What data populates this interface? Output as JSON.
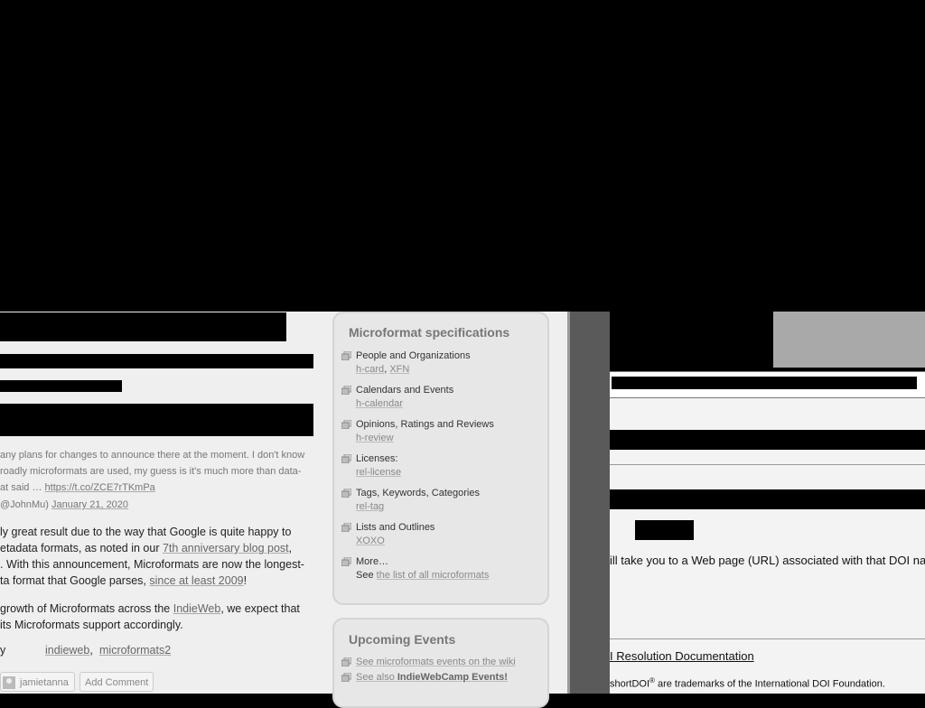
{
  "tweet": {
    "lines": [
      "any plans for changes to announce there at the moment. I don't know",
      "roadly microformats are used, my guess is it's much more than data-"
    ],
    "line3_prefix": "at said … ",
    "link": "https://t.co/ZCE7rTKmPa",
    "author_handle": "@JohnMu)",
    "date": "January 21, 2020"
  },
  "post": {
    "para1": {
      "l1": "ly great result due to the way that Google is quite happy to",
      "l2_prefix": "etadata formats, as noted in our ",
      "l2_link": "7th anniversary blog post",
      "l2_suffix": ",",
      "l3": ". With this announcement, Microformats are now the longest-",
      "l4_prefix": "ta format that Google parses, ",
      "l4_link": "since at least 2009",
      "l4_suffix": "!"
    },
    "para2": {
      "l1_prefix": " growth of Microformats across the ",
      "l1_link": "IndieWeb",
      "l1_suffix": ", we expect that",
      "l2": " its Microformats support accordingly."
    },
    "tags_label": "y",
    "tags": [
      "indieweb",
      "microformats2"
    ],
    "tag_separator": ",",
    "author": "jamietanna",
    "add_comment": "Add Comment"
  },
  "sidebar": {
    "specs_title": "Microformat specifications",
    "specs": [
      {
        "label": "People and Organizations",
        "links": [
          "h-card",
          "XFN"
        ]
      },
      {
        "label": "Calendars and Events",
        "links": [
          "h-calendar"
        ]
      },
      {
        "label": "Opinions, Ratings and Reviews",
        "links": [
          "h-review"
        ]
      },
      {
        "label": "Licenses:",
        "links": [
          "rel-license"
        ]
      },
      {
        "label": "Tags, Keywords, Categories",
        "links": [
          "rel-tag"
        ]
      },
      {
        "label": "Lists and Outlines",
        "links": [
          "XOXO"
        ]
      }
    ],
    "more": {
      "label": "More…",
      "prefix": "See ",
      "link": "the list of all microformats"
    },
    "events_title": "Upcoming Events",
    "events": [
      {
        "prefix": "",
        "link": "See microformats events on the wiki",
        "bold": ""
      },
      {
        "prefix": "See also ",
        "link": "",
        "bold": "IndieWebCamp Events!"
      }
    ]
  },
  "doi": {
    "text": "ill take you to a Web page (URL) associated with that DOI na",
    "doc_link": "I Resolution Documentation",
    "tm_prefix": "shortDOI",
    "tm_sup": "®",
    "tm_suffix": " are trademarks of the International DOI Foundation."
  },
  "colors": {
    "page_bg": "#efefef",
    "sidebar_bg": "#e7e7e7",
    "link": "#777777",
    "divider": "#5a5a5a"
  }
}
